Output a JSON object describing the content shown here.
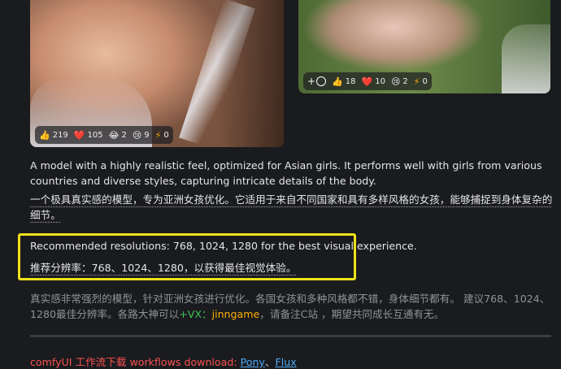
{
  "images": {
    "left": {
      "reactions": {
        "like": "219",
        "heart": "105",
        "laugh": "2",
        "cry": "9",
        "tip": "0"
      }
    },
    "right": {
      "reactions": {
        "like": "18",
        "heart": "10",
        "cry": "2",
        "tip": "0"
      }
    }
  },
  "description": {
    "en": "A model with a highly realistic feel, optimized for Asian girls. It performs well with girls from various countries and diverse styles, capturing intricate details of the body.",
    "zh": "一个极具真实感的模型，专为亚洲女孩优化。它适用于来自不同国家和具有多样风格的女孩，能够捕捉到身体复杂的细节。",
    "rec_en": "Recommended resolutions: 768, 1024, 1280 for the best visual experience.",
    "rec_zh": "推荐分辨率：768、1024、1280，以获得最佳视觉体验。",
    "zh2_part1": "真实感非常强烈的模型，针对亚洲女孩进行优化。各国女孩和多种风格都不错，身体细节都有。 建议768、1024、1280最佳分辨率。各路大神可以",
    "vx": "+VX：",
    "jinngame": "jinngame",
    "zh2_part2": "，请备注C站 ，期望共同成长互通有无。"
  },
  "workflows": {
    "label": "comfyUI 工作流下载 workflows download: ",
    "pony": "Pony",
    "sep": "、",
    "flux": "Flux"
  },
  "colors": {
    "background": "#1a1b1e",
    "highlight": "#f0e11a",
    "link": "#4dabf7",
    "red_text": "#fa5252",
    "green": "#40c057",
    "orange": "#fab005"
  }
}
